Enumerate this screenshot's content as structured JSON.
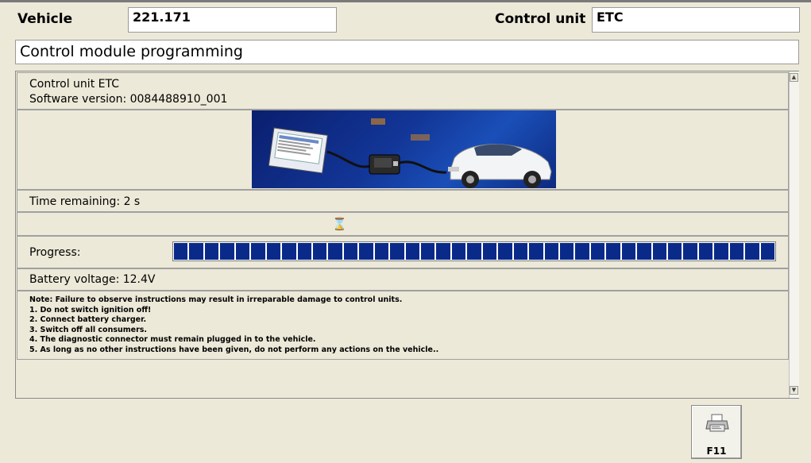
{
  "header": {
    "vehicle_label": "Vehicle",
    "vehicle_value": "221.171",
    "control_unit_label": "Control unit",
    "control_unit_value": "ETC"
  },
  "title": "Control module programming",
  "info": {
    "line1": "Control unit ETC",
    "line2": "Software version: 0084488910_001"
  },
  "banner": {
    "icon": "diagnostic-banner-image",
    "accent": "#123596"
  },
  "time_remaining": "Time remaining: 2 s",
  "status_icon": "hourglass-icon",
  "progress": {
    "label": "Progress:",
    "percent": 100,
    "color": "#0a2a8a"
  },
  "battery": "Battery voltage: 12.4V",
  "notes": [
    "Note:  Failure to observe instructions may result in irreparable damage to control units.",
    "1. Do not switch ignition off!",
    "2. Connect battery charger.",
    "3. Switch off all consumers.",
    "4. The diagnostic connector must remain plugged in to the vehicle.",
    "5. As long as no other instructions have been given, do not perform any actions on the vehicle.."
  ],
  "print_button": {
    "label": "F11",
    "icon": "printer-icon"
  }
}
